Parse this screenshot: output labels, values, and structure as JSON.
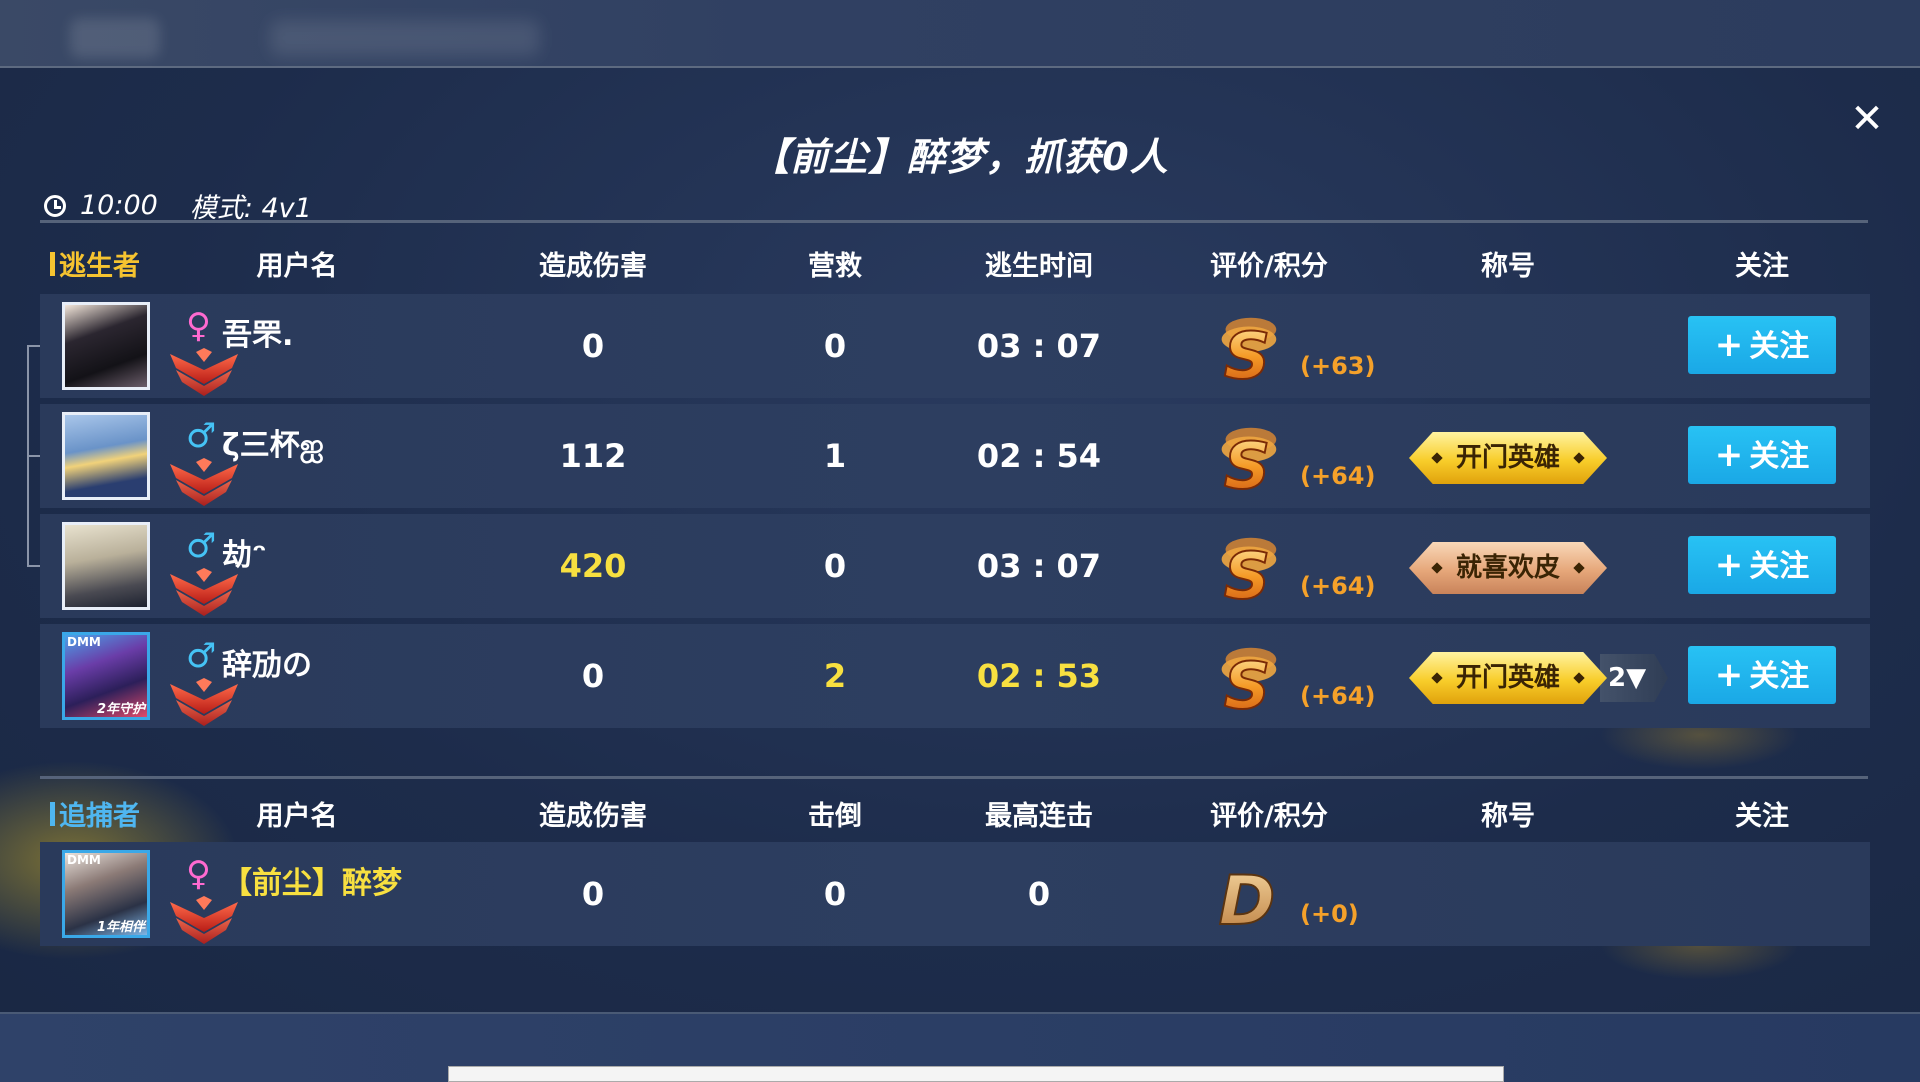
{
  "title": "【前尘】醉梦，抓获0人",
  "meta": {
    "time": "10:00",
    "mode": "模式: 4v1"
  },
  "survivor_section": {
    "label": "逃生者",
    "headers": [
      "用户名",
      "造成伤害",
      "营救",
      "逃生时间",
      "评价/积分",
      "称号",
      "关注"
    ],
    "players": [
      {
        "gender": "♀",
        "name": "吾罘.",
        "damage": "0",
        "rescue": "0",
        "escape_time": "03 : 07",
        "grade": "S",
        "points": "(+63)",
        "title": "",
        "title_count": "",
        "follow": "关注"
      },
      {
        "gender": "♂",
        "name": "ζ三杯ஐ",
        "damage": "112",
        "rescue": "1",
        "escape_time": "02 : 54",
        "grade": "S",
        "points": "(+64)",
        "title": "开门英雄",
        "title_count": "",
        "follow": "关注"
      },
      {
        "gender": "♂",
        "name": "劫ᵔ",
        "damage": "420",
        "rescue": "0",
        "escape_time": "03 : 07",
        "grade": "S",
        "points": "(+64)",
        "title": "就喜欢皮",
        "title_count": "",
        "follow": "关注"
      },
      {
        "gender": "♂",
        "name": "辞劢の",
        "damage": "0",
        "rescue": "2",
        "escape_time": "02 : 53",
        "grade": "S",
        "points": "(+64)",
        "title": "开门英雄",
        "title_count": "2▼",
        "follow": "关注"
      }
    ]
  },
  "hunter_section": {
    "label": "追捕者",
    "headers": [
      "用户名",
      "造成伤害",
      "击倒",
      "最高连击",
      "评价/积分",
      "称号",
      "关注"
    ],
    "players": [
      {
        "gender": "♀",
        "name": "【前尘】醉梦",
        "damage": "0",
        "knockdowns": "0",
        "max_combo": "0",
        "grade": "D",
        "points": "(+0)"
      }
    ]
  },
  "avatar_badges": {
    "dmm": "DMM",
    "year2": "2年守护",
    "year1": "1年相伴"
  },
  "colors": {
    "accent_yellow": "#f5c330",
    "accent_blue": "#4fb6f0",
    "follow_button": "#1fb3ec",
    "points_orange": "#f5a12a"
  },
  "icons": {
    "close": "close-icon",
    "clock": "clock-icon",
    "rank": "rank-chevron-icon",
    "grade": "grade-emblem"
  }
}
